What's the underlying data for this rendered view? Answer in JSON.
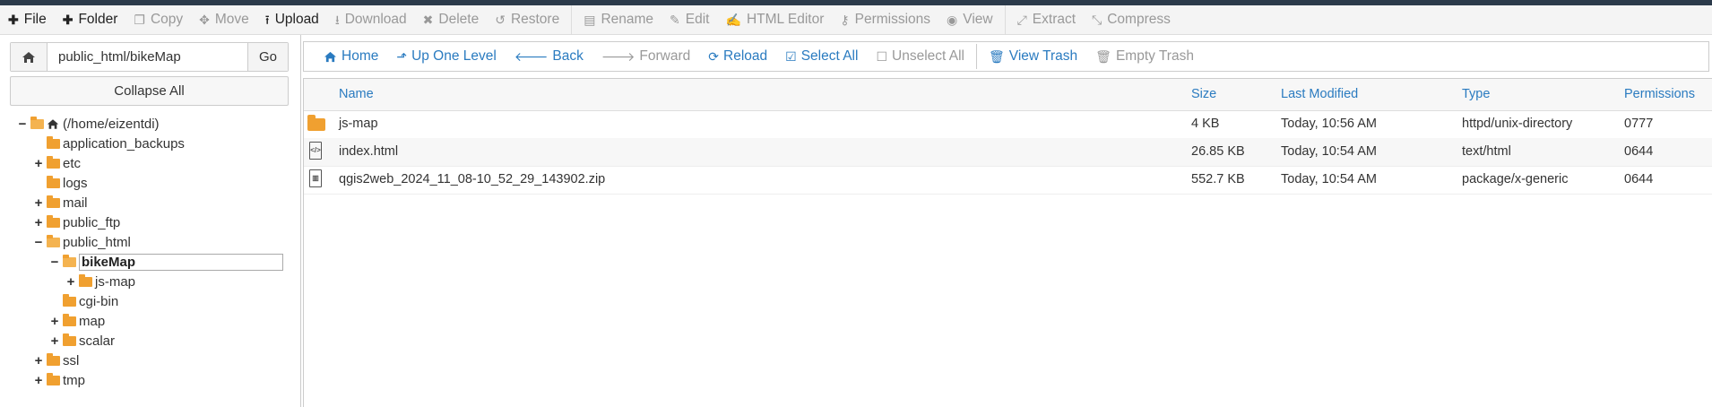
{
  "toolbar": {
    "items": [
      {
        "label": "File",
        "icon": "plus-icon",
        "enabled": true
      },
      {
        "label": "Folder",
        "icon": "plus-icon",
        "enabled": true
      },
      {
        "label": "Copy",
        "icon": "copy-icon",
        "enabled": false
      },
      {
        "label": "Move",
        "icon": "move-icon",
        "enabled": false
      },
      {
        "label": "Upload",
        "icon": "upload-icon",
        "enabled": true
      },
      {
        "label": "Download",
        "icon": "download-icon",
        "enabled": false
      },
      {
        "label": "Delete",
        "icon": "x-icon",
        "enabled": false
      },
      {
        "label": "Restore",
        "icon": "restore-icon",
        "enabled": false
      },
      {
        "label": "Rename",
        "icon": "file-icon",
        "enabled": false
      },
      {
        "label": "Edit",
        "icon": "pencil-icon",
        "enabled": false
      },
      {
        "label": "HTML Editor",
        "icon": "edit-box-icon",
        "enabled": false
      },
      {
        "label": "Permissions",
        "icon": "key-icon",
        "enabled": false
      },
      {
        "label": "View",
        "icon": "eye-icon",
        "enabled": false
      },
      {
        "label": "Extract",
        "icon": "expand-icon",
        "enabled": false
      },
      {
        "label": "Compress",
        "icon": "compress-icon",
        "enabled": false
      }
    ]
  },
  "path": {
    "value": "public_html/bikeMap",
    "go_label": "Go"
  },
  "collapse_label": "Collapse All",
  "tree": [
    {
      "label": "(/home/eizentdi)",
      "toggle": "−",
      "level": 0,
      "icon": "home-folder"
    },
    {
      "label": "application_backups",
      "toggle": "",
      "level": 1
    },
    {
      "label": "etc",
      "toggle": "+",
      "level": 1
    },
    {
      "label": "logs",
      "toggle": "",
      "level": 1
    },
    {
      "label": "mail",
      "toggle": "+",
      "level": 1
    },
    {
      "label": "public_ftp",
      "toggle": "+",
      "level": 1
    },
    {
      "label": "public_html",
      "toggle": "−",
      "level": 1,
      "open": true
    },
    {
      "label": "bikeMap",
      "toggle": "−",
      "level": 2,
      "open": true,
      "selected": true
    },
    {
      "label": "js-map",
      "toggle": "+",
      "level": 3
    },
    {
      "label": "cgi-bin",
      "toggle": "",
      "level": 2
    },
    {
      "label": "map",
      "toggle": "+",
      "level": 2
    },
    {
      "label": "scalar",
      "toggle": "+",
      "level": 2
    },
    {
      "label": "ssl",
      "toggle": "+",
      "level": 1
    },
    {
      "label": "tmp",
      "toggle": "+",
      "level": 1
    }
  ],
  "nav": {
    "items": [
      {
        "label": "Home",
        "icon": "home-icon",
        "enabled": true
      },
      {
        "label": "Up One Level",
        "icon": "level-up-icon",
        "enabled": true
      },
      {
        "label": "Back",
        "icon": "arrow-left-icon",
        "enabled": true
      },
      {
        "label": "Forward",
        "icon": "arrow-right-icon",
        "enabled": false
      },
      {
        "label": "Reload",
        "icon": "refresh-icon",
        "enabled": true
      },
      {
        "label": "Select All",
        "icon": "checkbox-checked-icon",
        "enabled": true
      },
      {
        "label": "Unselect All",
        "icon": "checkbox-empty-icon",
        "enabled": false
      },
      {
        "label": "View Trash",
        "icon": "trash-icon",
        "enabled": true
      },
      {
        "label": "Empty Trash",
        "icon": "trash-icon",
        "enabled": false
      }
    ]
  },
  "table": {
    "headers": {
      "name": "Name",
      "size": "Size",
      "modified": "Last Modified",
      "type": "Type",
      "perms": "Permissions"
    },
    "rows": [
      {
        "icon": "folder",
        "name": "js-map",
        "size": "4 KB",
        "modified": "Today, 10:56 AM",
        "type": "httpd/unix-directory",
        "perms": "0777"
      },
      {
        "icon": "html",
        "name": "index.html",
        "size": "26.85 KB",
        "modified": "Today, 10:54 AM",
        "type": "text/html",
        "perms": "0644"
      },
      {
        "icon": "zip",
        "name": "qgis2web_2024_11_08-10_52_29_143902.zip",
        "size": "552.7 KB",
        "modified": "Today, 10:54 AM",
        "type": "package/x-generic",
        "perms": "0644"
      }
    ]
  },
  "colors": {
    "link": "#2a7bc0",
    "folder": "#f0a030",
    "disabled": "#999999"
  }
}
